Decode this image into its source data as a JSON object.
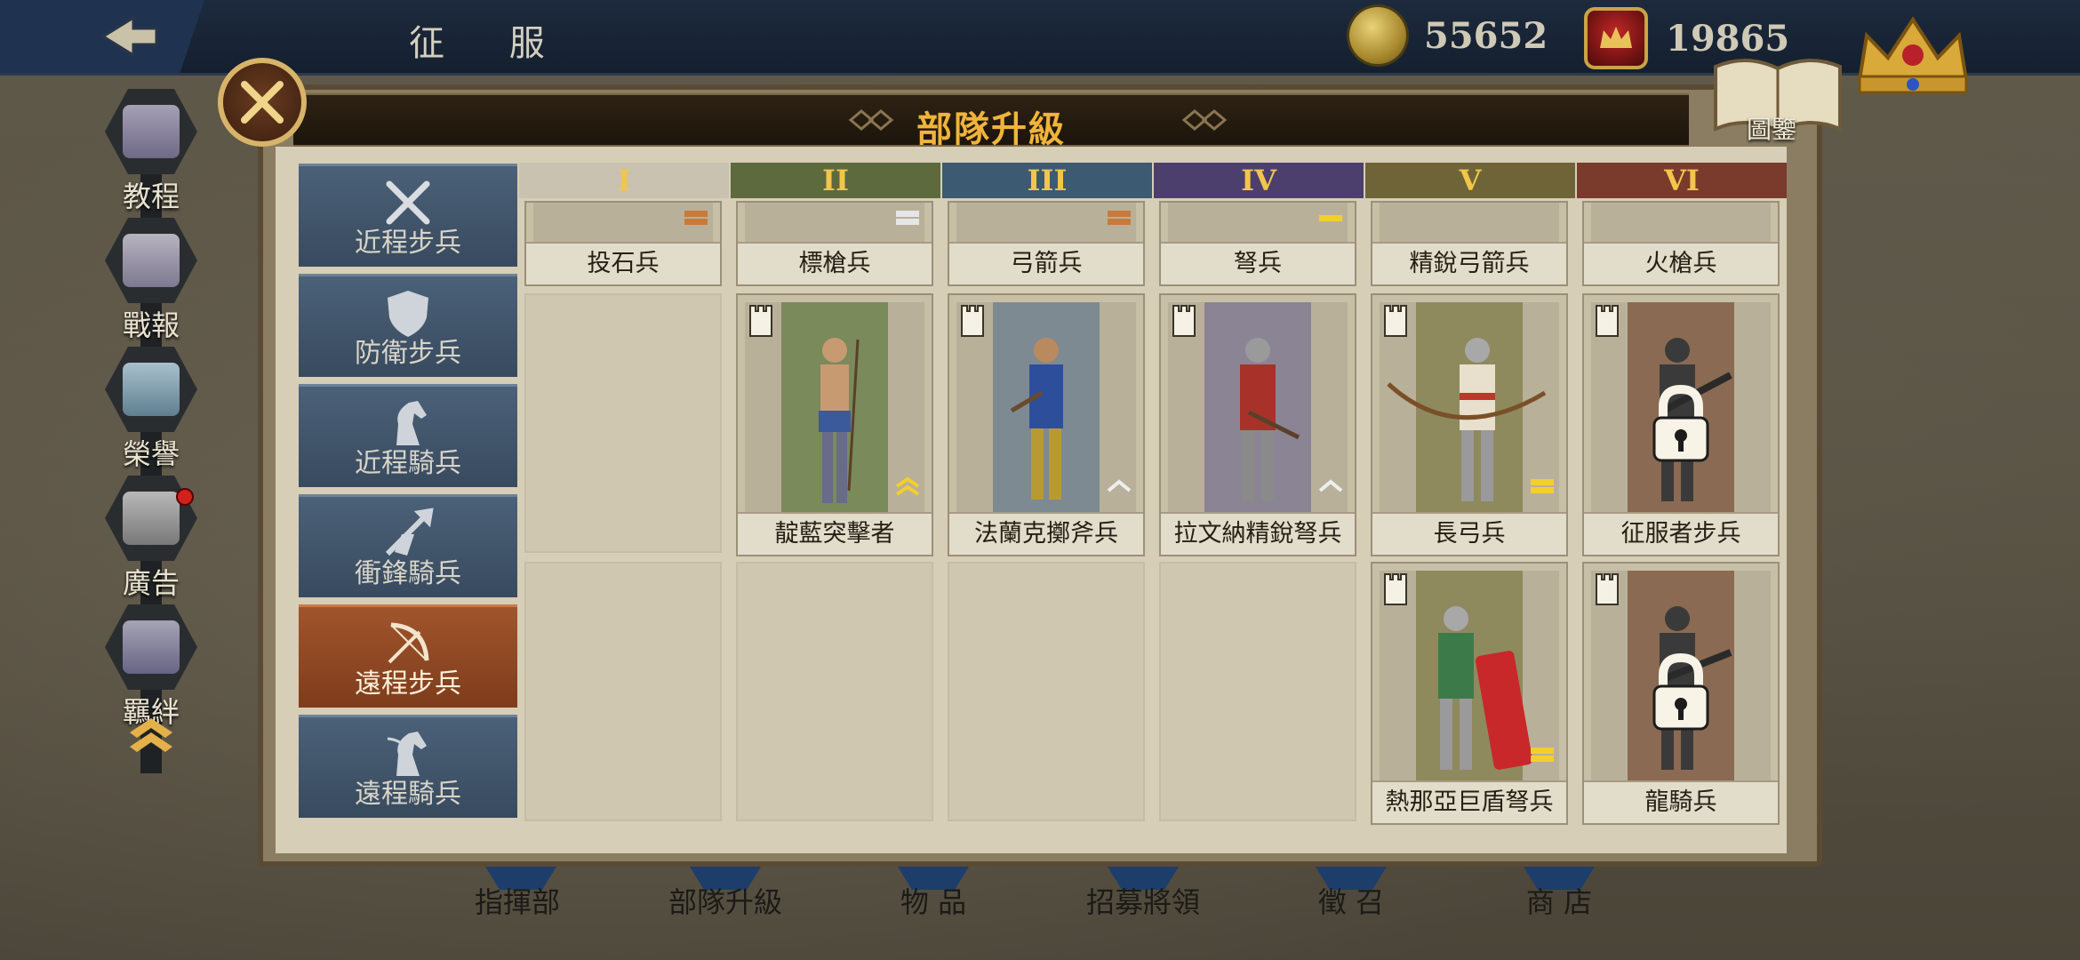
{
  "topbar": {
    "title": "征 服",
    "coins": "55652",
    "crowns": "19865"
  },
  "sidebar": {
    "items": [
      {
        "label": "教程",
        "icon": "book-icon"
      },
      {
        "label": "戰報",
        "icon": "scroll-icon"
      },
      {
        "label": "榮譽",
        "icon": "sword-banner-icon"
      },
      {
        "label": "廣告",
        "icon": "film-icon"
      },
      {
        "label": "羈絆",
        "icon": "handshake-icon"
      }
    ]
  },
  "panel": {
    "title": "部隊升級",
    "book_label": "圖鑒"
  },
  "categories": [
    {
      "label": "近程步兵",
      "icon": "crossed-swords-icon"
    },
    {
      "label": "防衛步兵",
      "icon": "shield-icon"
    },
    {
      "label": "近程騎兵",
      "icon": "horse-icon"
    },
    {
      "label": "衝鋒騎兵",
      "icon": "lance-icon"
    },
    {
      "label": "遠程步兵",
      "icon": "bow-icon"
    },
    {
      "label": "遠程騎兵",
      "icon": "horse-archer-icon"
    }
  ],
  "tiers": [
    {
      "label": "I",
      "color": "#c9c2b0"
    },
    {
      "label": "II",
      "color": "#5d6a3d"
    },
    {
      "label": "III",
      "color": "#3c5a72"
    },
    {
      "label": "IV",
      "color": "#4c3f6e"
    },
    {
      "label": "V",
      "color": "#6e6438"
    },
    {
      "label": "VI",
      "color": "#7a3a2c"
    }
  ],
  "row1": [
    "投石兵",
    "標槍兵",
    "弓箭兵",
    "弩兵",
    "精銳弓箭兵",
    "火槍兵"
  ],
  "row2": [
    "",
    "靛藍突擊者",
    "法蘭克擲斧兵",
    "拉文納精銳弩兵",
    "長弓兵",
    "征服者步兵"
  ],
  "row3": [
    "",
    "",
    "",
    "",
    "熱那亞巨盾弩兵",
    "龍騎兵"
  ],
  "bottom_nav": [
    "指揮部",
    "部隊升級",
    "物 品",
    "招募將領",
    "徵 召",
    "商 店"
  ]
}
